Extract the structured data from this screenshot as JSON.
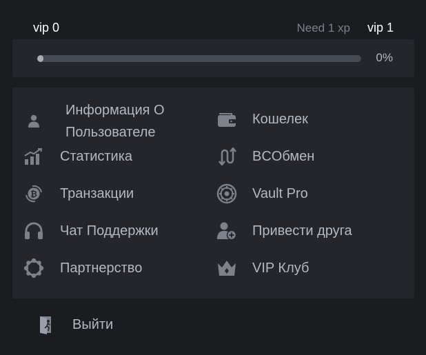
{
  "vip": {
    "current": "vip 0",
    "need": "Need 1 xp",
    "next": "vip 1",
    "progress_percent": 0,
    "progress_label": "0%"
  },
  "menu": {
    "left": [
      {
        "label": "Информация О Пользователе",
        "icon": "user-icon"
      },
      {
        "label": "Статистика",
        "icon": "statistics-icon"
      },
      {
        "label": "Транзакции",
        "icon": "transactions-icon"
      },
      {
        "label": "Чат Поддержки",
        "icon": "headphones-icon"
      },
      {
        "label": "Партнерство",
        "icon": "partnership-icon"
      }
    ],
    "right": [
      {
        "label": "Кошелек",
        "icon": "wallet-icon"
      },
      {
        "label": "BCОбмен",
        "icon": "exchange-icon"
      },
      {
        "label": "Vault Pro",
        "icon": "vault-icon"
      },
      {
        "label": "Привести друга",
        "icon": "add-friend-icon"
      },
      {
        "label": "VIP Клуб",
        "icon": "crown-icon"
      }
    ]
  },
  "logout": {
    "label": "Выйти",
    "icon": "logout-icon"
  },
  "colors": {
    "background": "#1a1c20",
    "card": "#24262b",
    "text": "#b4b8c0",
    "icon": "#7d818a"
  }
}
